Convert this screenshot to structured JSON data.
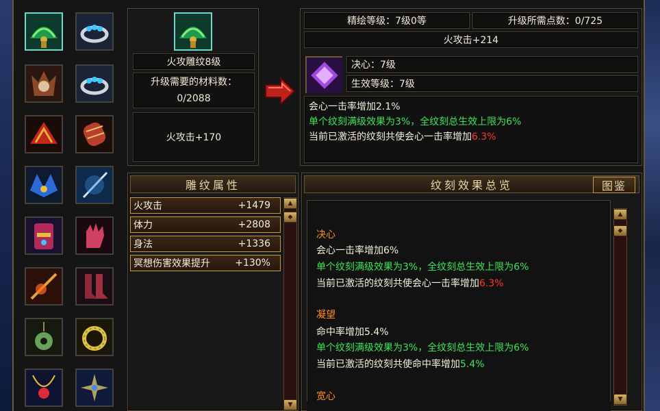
{
  "item": {
    "name": "火攻雕纹8级",
    "material_label": "升级需要的材料数：",
    "material_value": "0/2088",
    "attr": "火攻击+170"
  },
  "upgrade": {
    "level": "精绘等级：7级0等",
    "points": "升级所需点数：0/725",
    "attr": "火攻击+214",
    "rune_name": "决心：7级",
    "rune_effect_level": "生效等级：7级",
    "effect_line1": "会心一击率增加2.1%",
    "effect_line2": "单个纹刻满级效果为3%，全纹刻总生效上限为6%",
    "effect_line3_prefix": "当前已激活的纹刻共使会心一击率增加",
    "effect_line3_value": "6.3%"
  },
  "attributes": {
    "title": "雕纹属性",
    "rows": [
      {
        "name": "火攻击",
        "value": "+1479"
      },
      {
        "name": "体力",
        "value": "+2808"
      },
      {
        "name": "身法",
        "value": "+1336"
      },
      {
        "name": "冥想伤害效果提升",
        "value": "+130%"
      }
    ]
  },
  "overview": {
    "title": "纹刻效果总览",
    "button": "图鉴",
    "groups": [
      {
        "name": "决心",
        "line1": "会心一击率增加6%",
        "line2": "单个纹刻满级效果为3%，全纹刻总生效上限为6%",
        "line3_prefix": "当前已激活的纹刻共使会心一击率增加",
        "line3_value": "6.3%"
      },
      {
        "name": "凝望",
        "line1": "命中率增加5.4%",
        "line2": "单个纹刻满级效果为3%，全纹刻总生效上限为6%",
        "line3_prefix": "当前已激活的纹刻共使命中率增加",
        "line3_value": "5.4%"
      }
    ],
    "partial_next": "宽心"
  },
  "equipment_icons": [
    "peacock-fan-icon",
    "jeweled-ring-icon",
    "beast-helm-icon",
    "jeweled-ring-icon",
    "red-shoulder-icon",
    "red-bracer-icon",
    "blue-shoulder-icon",
    "blue-blade-icon",
    "ornate-armor-icon",
    "red-glove-icon",
    "flame-spear-icon",
    "red-boots-icon",
    "jade-pendant-icon",
    "gold-bangle-icon",
    "ruby-necklace-icon",
    "shuriken-icon"
  ],
  "colors": {
    "highlight_name": "#ff8c2a",
    "green_text": "#3ee45a",
    "red_value": "#ff3a2a",
    "frame_gold": "#c79a4a"
  }
}
